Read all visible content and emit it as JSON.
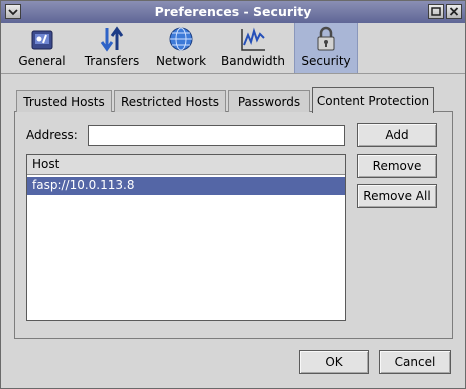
{
  "window": {
    "title": "Preferences - Security"
  },
  "toolbar": {
    "items": [
      {
        "label": "General",
        "icon": "general-icon",
        "selected": false
      },
      {
        "label": "Transfers",
        "icon": "transfer-arrows-icon",
        "selected": false
      },
      {
        "label": "Network",
        "icon": "globe-icon",
        "selected": false
      },
      {
        "label": "Bandwidth",
        "icon": "bandwidth-graph-icon",
        "selected": false
      },
      {
        "label": "Security",
        "icon": "padlock-icon",
        "selected": true
      }
    ]
  },
  "tabs": [
    {
      "label": "Trusted Hosts",
      "active": false
    },
    {
      "label": "Restricted Hosts",
      "active": false
    },
    {
      "label": "Passwords",
      "active": false
    },
    {
      "label": "Content Protection",
      "active": true
    }
  ],
  "form": {
    "address_label": "Address:",
    "address_value": "",
    "address_placeholder": ""
  },
  "hosts_list": {
    "header": "Host",
    "rows": [
      {
        "host": "fasp://10.0.113.8",
        "selected": true
      }
    ]
  },
  "side_buttons": {
    "add": "Add",
    "remove": "Remove",
    "remove_all": "Remove All"
  },
  "dialog_buttons": {
    "ok": "OK",
    "cancel": "Cancel"
  },
  "colors": {
    "titlebar": "#5f6696",
    "selection": "#5466a6",
    "selected_tool": "#a9b6d6",
    "background": "#d6d6d6"
  }
}
